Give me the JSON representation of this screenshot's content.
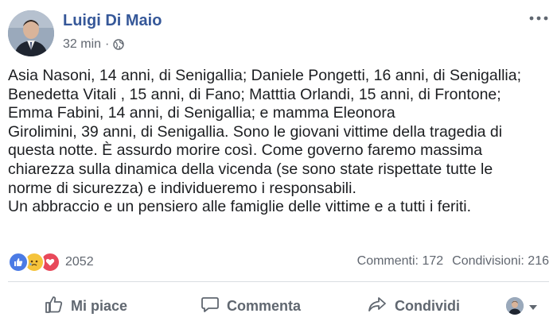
{
  "post": {
    "author": "Luigi Di Maio",
    "time": "32 min",
    "separator": "·",
    "lines": [
      "Asia Nasoni, 14 anni, di Senigallia; Daniele Pongetti, 16 anni, di Senigallia;",
      "Benedetta Vitali , 15 anni, di Fano; Matttia Orlandi, 15 anni, di Frontone;",
      "Emma Fabini, 14 anni, di Senigallia; e mamma Eleonora",
      "Girolimini, 39 anni, di Senigallia. Sono le giovani vittime della tragedia di",
      "questa notte. È assurdo morire così. Come governo faremo massima",
      "chiarezza sulla dinamica della vicenda (se sono state rispettate tutte le",
      "norme di sicurezza) e individueremo i responsabili.",
      "Un abbraccio e un pensiero alle famiglie delle vittime e a tutti i feriti."
    ]
  },
  "reactions": {
    "icons": [
      "like-icon",
      "sad-face-icon",
      "love-icon"
    ],
    "count": "2052"
  },
  "stats": {
    "comments": "Commenti: 172",
    "shares": "Condivisioni: 216"
  },
  "actions": {
    "like": "Mi piace",
    "comment": "Commenta",
    "share": "Condividi"
  },
  "colors": {
    "author": "#365899",
    "like": "#4b7be5",
    "love": "#e8495a",
    "sad": "#f5c33b",
    "muted": "#616770"
  }
}
